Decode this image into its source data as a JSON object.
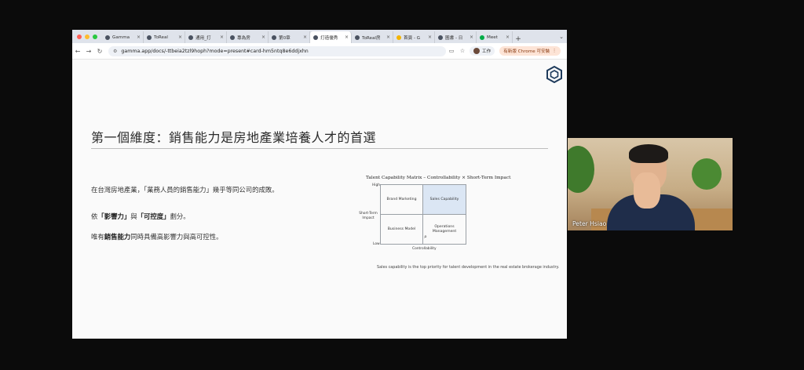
{
  "browser": {
    "traffic_lights": [
      "#ff5f57",
      "#febc2e",
      "#28c840"
    ],
    "tabs": [
      {
        "title": "Gamma",
        "active": false
      },
      {
        "title": "ToReal",
        "active": false
      },
      {
        "title": "通用_打",
        "active": false
      },
      {
        "title": "專為房",
        "active": false
      },
      {
        "title": "第0章",
        "active": false
      },
      {
        "title": "打造優秀",
        "active": true
      },
      {
        "title": "ToReal房",
        "active": false
      },
      {
        "title": "首頁 - G",
        "active": false
      },
      {
        "title": "圖書 - 日",
        "active": false
      },
      {
        "title": "Meet",
        "active": false
      }
    ],
    "new_tab_icon": "+",
    "url": "gamma.app/docs/-ttbeia2tzl9hoph?mode=present#card-hm5ntq8e6ddjxhn",
    "profile_label": "工作",
    "update_label": "有新版 Chrome 可安裝"
  },
  "slide": {
    "title": "第一個維度：銷售能力是房地產業培養人才的首選",
    "p1": "在台灣房地產業，「業務人員的銷售能力」幾乎等同公司的成敗。",
    "p2": {
      "a": "依",
      "b": "「影響力」",
      "c": "與",
      "d": "「可控度」",
      "e": "劃分。"
    },
    "p3": {
      "a": "唯有",
      "b": "銷售能力",
      "c": "同時具備高影響力與高可控性。"
    },
    "caption": "Sales capability is the top priority for talent development in the real estate brokerage industry."
  },
  "chart_data": {
    "type": "table",
    "title": "Talent Capability Matrix – Controllability × Short-Term Impact",
    "ylabel": "Short-Term Impact",
    "xlabel": "Controllability",
    "y_ticks": [
      "High",
      "Low"
    ],
    "quadrants": [
      {
        "position": "top-left",
        "label": "Brand Marketing",
        "highlighted": false
      },
      {
        "position": "top-right",
        "label": "Sales Capability",
        "highlighted": true,
        "color": "#dbe6f4"
      },
      {
        "position": "bottom-left",
        "label": "Business Model",
        "highlighted": false
      },
      {
        "position": "bottom-right",
        "label": "Operations Management",
        "highlighted": false
      }
    ]
  },
  "video": {
    "participant_name": "Peter Hsiao"
  }
}
